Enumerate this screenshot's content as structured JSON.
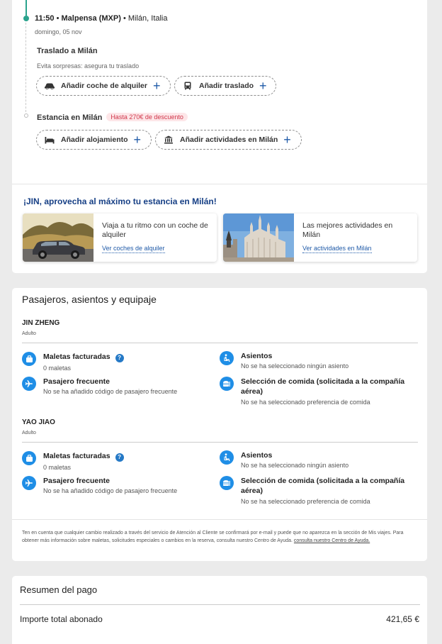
{
  "itinerary": {
    "arrival_time": "11:50",
    "arrival_airport": "Malpensa (MXP)",
    "arrival_city": "Milán, Italia",
    "arrival_date": "domingo, 05 nov",
    "transfer": {
      "title": "Traslado a Milán",
      "subtitle": "Evita sorpresas: asegura tu traslado",
      "car_rental_button": "Añadir coche de alquiler",
      "transfer_button": "Añadir traslado"
    },
    "stay": {
      "title": "Estancia en Milán",
      "discount_badge": "Hasta 270€ de descuento",
      "hotel_button": "Añadir alojamiento",
      "activities_button": "Añadir actividades en Milán"
    },
    "promo": {
      "title": "¡JIN, aprovecha al máximo tu estancia en Milán!",
      "cards": [
        {
          "text": "Viaja a tu ritmo con un coche de alquiler",
          "link": "Ver coches de alquiler",
          "image": "car-photo"
        },
        {
          "text": "Las mejores actividades en Milán",
          "link": "Ver actividades en Milán",
          "image": "milan-cathedral-photo"
        }
      ]
    }
  },
  "passengers_section": {
    "title": "Pasajeros, asientos y equipaje",
    "passengers": [
      {
        "name": "JIN ZHENG",
        "type": "Adulto",
        "bags_title": "Maletas facturadas",
        "bags_value": "0 maletas",
        "seats_title": "Asientos",
        "seats_value": "No se ha seleccionado ningún asiento",
        "ff_title": "Pasajero frecuente",
        "ff_value": "No se ha añadido código de pasajero frecuente",
        "meal_title_1": "Selección de comida (solicitada a la compañía",
        "meal_title_2": "aérea)",
        "meal_value": "No se ha seleccionado preferencia de comida"
      },
      {
        "name": "YAO JIAO",
        "type": "Adulto",
        "bags_title": "Maletas facturadas",
        "bags_value": "0 maletas",
        "seats_title": "Asientos",
        "seats_value": "No se ha seleccionado ningún asiento",
        "ff_title": "Pasajero frecuente",
        "ff_value": "No se ha añadido código de pasajero frecuente",
        "meal_title_1": "Selección de comida (solicitada a la compañía",
        "meal_title_2": "aérea)",
        "meal_value": "No se ha seleccionado preferencia de comida"
      }
    ],
    "note_text": "Ten en cuenta que cualquier cambio realizado a través del servicio de Atención al Cliente se confirmará por e-mail y puede que no aparezca en la sección de Mis viajes. Para obtener más información sobre maletas, solicitudes especiales o cambios en la reserva, consulta nuestro Centro de Ayuda.",
    "note_link": "consulta nuestro Centro de Ayuda."
  },
  "payment": {
    "title": "Resumen del pago",
    "total_label": "Importe total abonado",
    "total_amount": "421,65 €"
  },
  "colors": {
    "accent_blue": "#1f5aa8",
    "icon_blue": "#1f8ee6",
    "timeline_green": "#2aa38d",
    "discount_red": "#d0364a"
  }
}
